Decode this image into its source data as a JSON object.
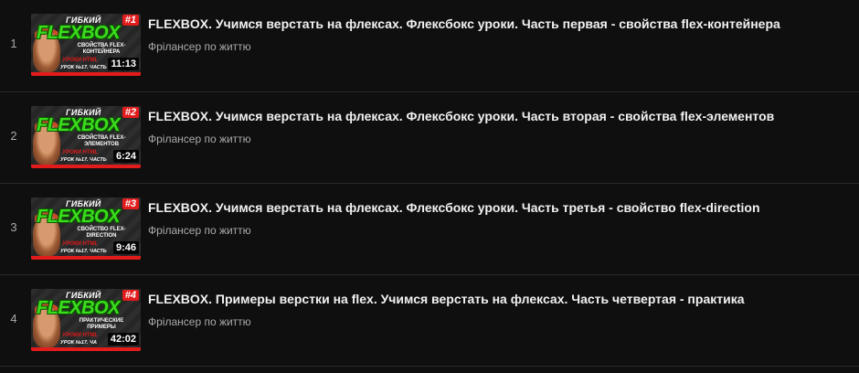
{
  "playlist": {
    "items": [
      {
        "index": "1",
        "title": "FLEXBOX. Учимся верстать на флексах. Флексбокс уроки. Часть первая - свойства flex-контейнера",
        "channel": "Фрілансер по життю",
        "duration": "11:13",
        "thumb": {
          "top_word": "ГИБКИЙ",
          "badge": "#1",
          "brand": "FLEXBOX",
          "subtitle": "свойства FLEX-КОНТЕЙНЕРА",
          "series": "УРОКИ HTML",
          "lesson": "УРОК №17. ЧАСТЬ"
        }
      },
      {
        "index": "2",
        "title": "FLEXBOX. Учимся верстать на флексах. Флексбокс уроки. Часть вторая - свойства flex-элементов",
        "channel": "Фрілансер по життю",
        "duration": "6:24",
        "thumb": {
          "top_word": "ГИБКИЙ",
          "badge": "#2",
          "brand": "FLEXBOX",
          "subtitle": "свойства FLEX-ЭЛЕМЕНТОВ",
          "series": "УРОКИ HTML",
          "lesson": "УРОК №17. ЧАСТЬ"
        }
      },
      {
        "index": "3",
        "title": "FLEXBOX. Учимся верстать на флексах. Флексбокс уроки. Часть третья - свойство flex-direction",
        "channel": "Фрілансер по життю",
        "duration": "9:46",
        "thumb": {
          "top_word": "ГИБКИЙ",
          "badge": "#3",
          "brand": "FLEXBOX",
          "subtitle": "свойство FLEX-DIRECTION",
          "series": "УРОКИ HTML",
          "lesson": "УРОК №17. ЧАСТЬ"
        }
      },
      {
        "index": "4",
        "title": "FLEXBOX. Примеры верстки на flex. Учимся верстать на флексах. Часть четвертая - практика",
        "channel": "Фрілансер по життю",
        "duration": "42:02",
        "thumb": {
          "top_word": "ГИБКИЙ",
          "badge": "#4",
          "brand": "FLEXBOX",
          "subtitle": "ПРАКТИЧЕСКИЕ ПРИМЕРЫ",
          "series": "УРОКИ HTML",
          "lesson": "УРОК №17. ЧА"
        }
      }
    ]
  },
  "colors": {
    "background": "#0f0f0f",
    "title_text": "#f1f1f1",
    "secondary_text": "#aaaaaa",
    "accent_red": "#e21b1b",
    "brand_green": "#3cdc1e"
  }
}
